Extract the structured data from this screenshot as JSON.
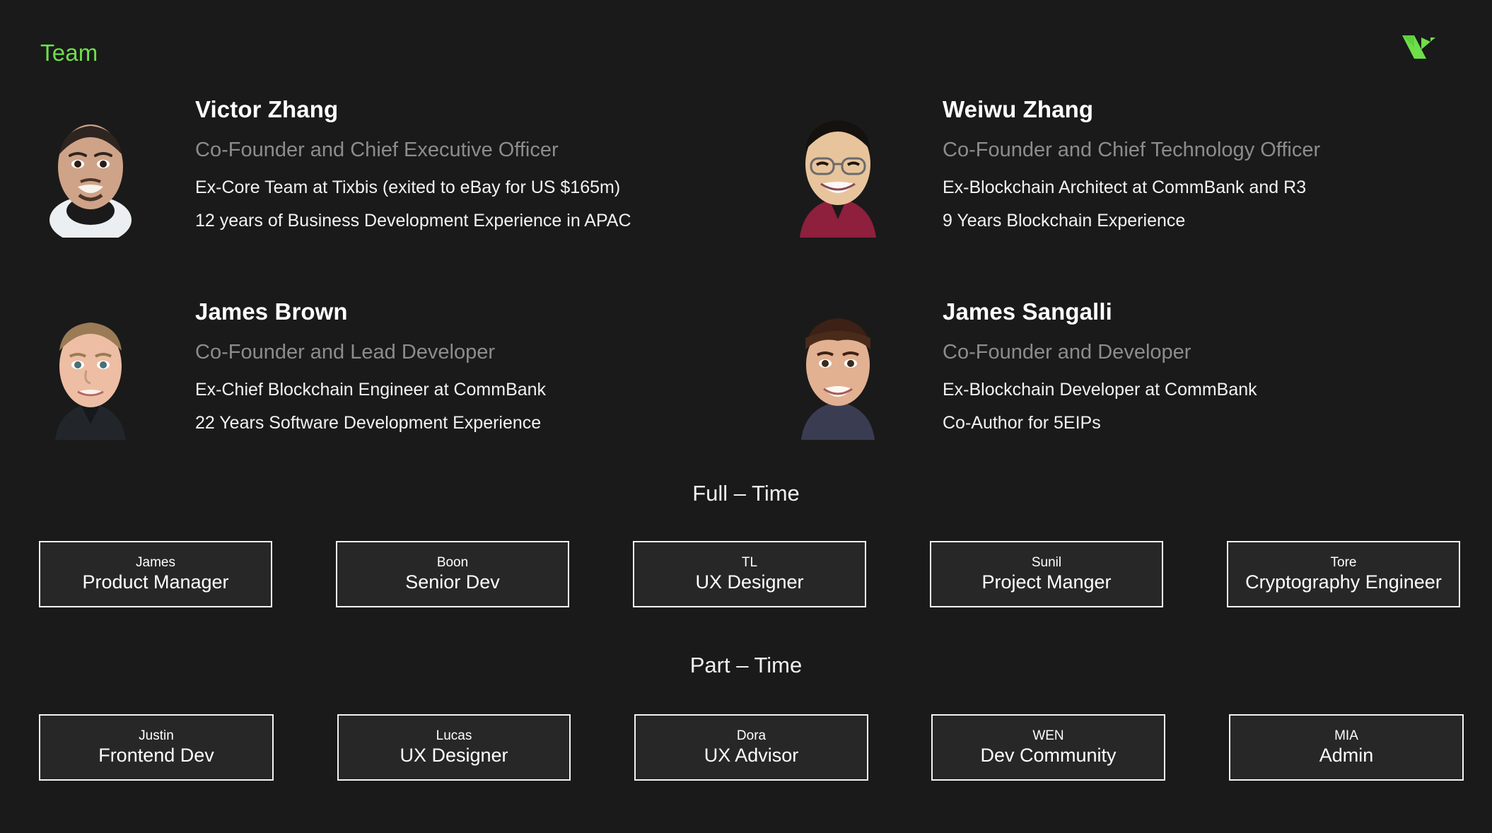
{
  "header": {
    "section_title": "Team",
    "logo_name": "origami-bird-logo",
    "accent_color": "#6ede4a"
  },
  "theme": {
    "background": "#1a1a1a",
    "box_fill": "#272727",
    "box_border": "#f4f4f4",
    "text_primary": "#ffffff",
    "text_muted": "#8c8c8c"
  },
  "founders": [
    {
      "name": "Victor Zhang",
      "role": "Co-Founder and Chief Executive Officer",
      "facts": [
        "Ex-Core Team at Tixbis (exited to eBay for US $165m)",
        "12 years of Business Development Experience in APAC"
      ],
      "photo_name": "victor-zhang-portrait"
    },
    {
      "name": "Weiwu Zhang",
      "role": "Co-Founder and Chief Technology Officer",
      "facts": [
        "Ex-Blockchain Architect at CommBank and R3",
        "9 Years Blockchain Experience"
      ],
      "photo_name": "weiwu-zhang-portrait"
    },
    {
      "name": "James Brown",
      "role": "Co-Founder and Lead Developer",
      "facts": [
        "Ex-Chief Blockchain Engineer at CommBank",
        "22 Years Software Development Experience"
      ],
      "photo_name": "james-brown-portrait"
    },
    {
      "name": "James Sangalli",
      "role": "Co-Founder and Developer",
      "facts": [
        "Ex-Blockchain Developer at CommBank",
        "Co-Author for 5EIPs"
      ],
      "photo_name": "james-sangalli-portrait"
    }
  ],
  "groups": [
    {
      "heading": "Full – Time",
      "members": [
        {
          "name": "James",
          "role": "Product Manager"
        },
        {
          "name": "Boon",
          "role": "Senior Dev"
        },
        {
          "name": "TL",
          "role": "UX Designer"
        },
        {
          "name": "Sunil",
          "role": "Project Manger"
        },
        {
          "name": "Tore",
          "role": "Cryptography Engineer"
        }
      ]
    },
    {
      "heading": "Part – Time",
      "members": [
        {
          "name": "Justin",
          "role": "Frontend Dev"
        },
        {
          "name": "Lucas",
          "role": "UX Designer"
        },
        {
          "name": "Dora",
          "role": "UX Advisor"
        },
        {
          "name": "WEN",
          "role": "Dev Community"
        },
        {
          "name": "MIA",
          "role": "Admin"
        }
      ]
    }
  ]
}
